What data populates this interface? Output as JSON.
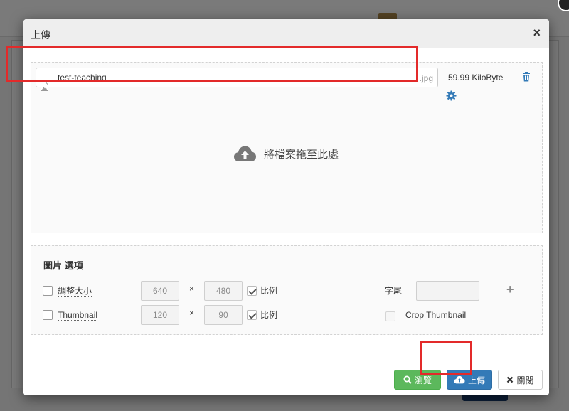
{
  "modal": {
    "title": "上傳",
    "close_glyph": "×"
  },
  "file": {
    "name": "test-teaching",
    "extension": ".jpg",
    "size": "59.99 KiloByte",
    "thumb_icon": "image-file-icon",
    "delete_icon": "trash-icon",
    "settings_icon": "gear-icon"
  },
  "dropzone": {
    "message": "將檔案拖至此處",
    "icon": "cloud-upload-icon"
  },
  "options": {
    "title": "圖片 選項",
    "resize": {
      "label": "調整大小",
      "checked": false,
      "width": "640",
      "height": "480",
      "times": "×",
      "ratio_label": "比例",
      "ratio_checked": true
    },
    "thumbnail": {
      "label": "Thumbnail",
      "checked": false,
      "width": "120",
      "height": "90",
      "times": "×",
      "ratio_label": "比例",
      "ratio_checked": true
    },
    "suffix_label": "字尾",
    "suffix_value": "",
    "crop_label": "Crop Thumbnail",
    "crop_checked": false,
    "add_glyph": "+"
  },
  "footer": {
    "browse_label": "瀏覽",
    "upload_label": "上傳",
    "close_label": "關閉"
  },
  "colors": {
    "highlight": "#e32a2a",
    "browse": "#5cb85c",
    "upload": "#337ab7",
    "accent_icon": "#337ab7"
  }
}
